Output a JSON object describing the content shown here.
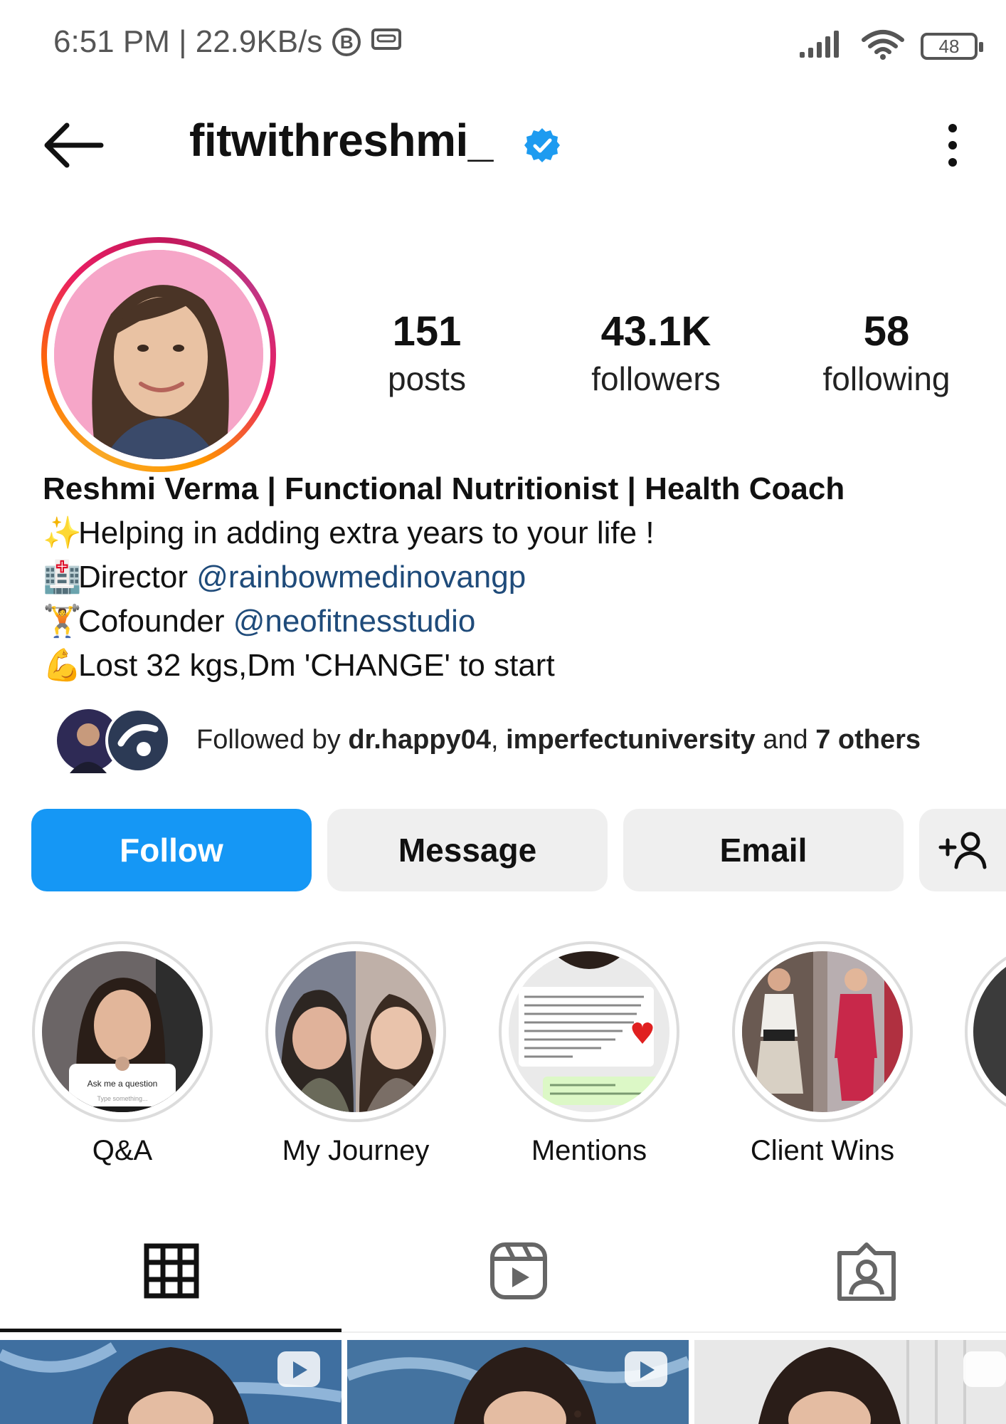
{
  "status_bar": {
    "left_text": "6:51 PM | 22.9KB/s",
    "b_icon": "B",
    "battery": "48"
  },
  "header": {
    "username": "fitwithreshmi_",
    "verified": true
  },
  "stats": [
    {
      "value": "151",
      "label": "posts"
    },
    {
      "value": "43.1K",
      "label": "followers"
    },
    {
      "value": "58",
      "label": "following"
    }
  ],
  "bio": {
    "name": "Reshmi Verma | Functional Nutritionist | Health Coach",
    "line1_emoji": "✨",
    "line1": "Helping in adding extra years to your life !",
    "line2_emoji": "🏥",
    "line2_prefix": "Director ",
    "line2_link": "@rainbowmedinovangp",
    "line3_emoji": "🏋",
    "line3_prefix": "Cofounder ",
    "line3_link": "@neofitnesstudio",
    "line4_emoji": "💪",
    "line4": "Lost 32 kgs,Dm 'CHANGE' to start"
  },
  "followed_by": {
    "prefix": "Followed by ",
    "user1": "dr.happy04",
    "sep": ", ",
    "user2": "imperfectuniversity",
    "middle": " and ",
    "others": "7 others"
  },
  "actions": {
    "follow": "Follow",
    "message": "Message",
    "email": "Email",
    "add_person_icon": "add-person-icon"
  },
  "highlights": [
    {
      "label": "Q&A",
      "sticker": "Ask me a question",
      "placeholder": "Type something..."
    },
    {
      "label": "My Journey"
    },
    {
      "label": "Mentions"
    },
    {
      "label": "Client Wins"
    }
  ],
  "tabs": [
    "grid-icon",
    "reels-icon",
    "tagged-icon"
  ],
  "colors": {
    "follow_blue": "#1597f5",
    "link_blue": "#1f4b7a",
    "verified_blue": "#1d9bf0"
  }
}
